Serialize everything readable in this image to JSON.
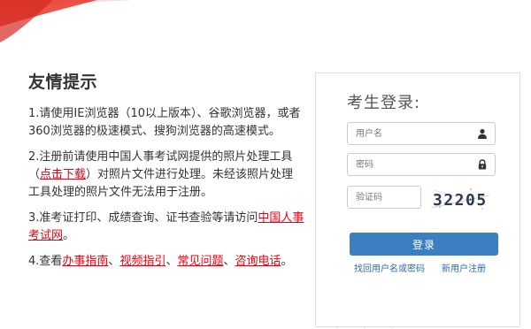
{
  "notice": {
    "title": "友情提示",
    "item1": "1.请使用IE浏览器（10以上版本）、谷歌浏览器，或者360浏览器的极速模式、搜狗浏览器的高速模式。",
    "item2_pre": "2.注册前请使用中国人事考试网提供的照片处理工具（",
    "item2_link": "点击下载",
    "item2_post": "）对照片文件进行处理。未经该照片处理工具处理的照片文件无法用于注册。",
    "item3_pre": "3.准考证打印、成绩查询、证书查验等请访问",
    "item3_link": "中国人事考试网",
    "item3_post": "。",
    "item4_pre": "4.查看",
    "item4_link1": "办事指南",
    "item4_sep1": "、",
    "item4_link2": "视频指引",
    "item4_sep2": "、",
    "item4_link3": "常见问题",
    "item4_sep3": "、",
    "item4_link4": "咨询电话",
    "item4_post": "。"
  },
  "login": {
    "title": "考生登录:",
    "username_placeholder": "用户名",
    "password_placeholder": "密码",
    "captcha_placeholder": "验证码",
    "captcha_text": "32205",
    "submit_label": "登录",
    "find_account_link": "找回用户名或密码",
    "register_link": "新用户注册"
  },
  "colors": {
    "link_red": "#e60012",
    "button_blue": "#3c7fc1",
    "link_blue": "#2b6cb0",
    "swoosh_red": "#e8362a"
  },
  "icons": {
    "username": "user-icon",
    "password": "lock-icon"
  }
}
